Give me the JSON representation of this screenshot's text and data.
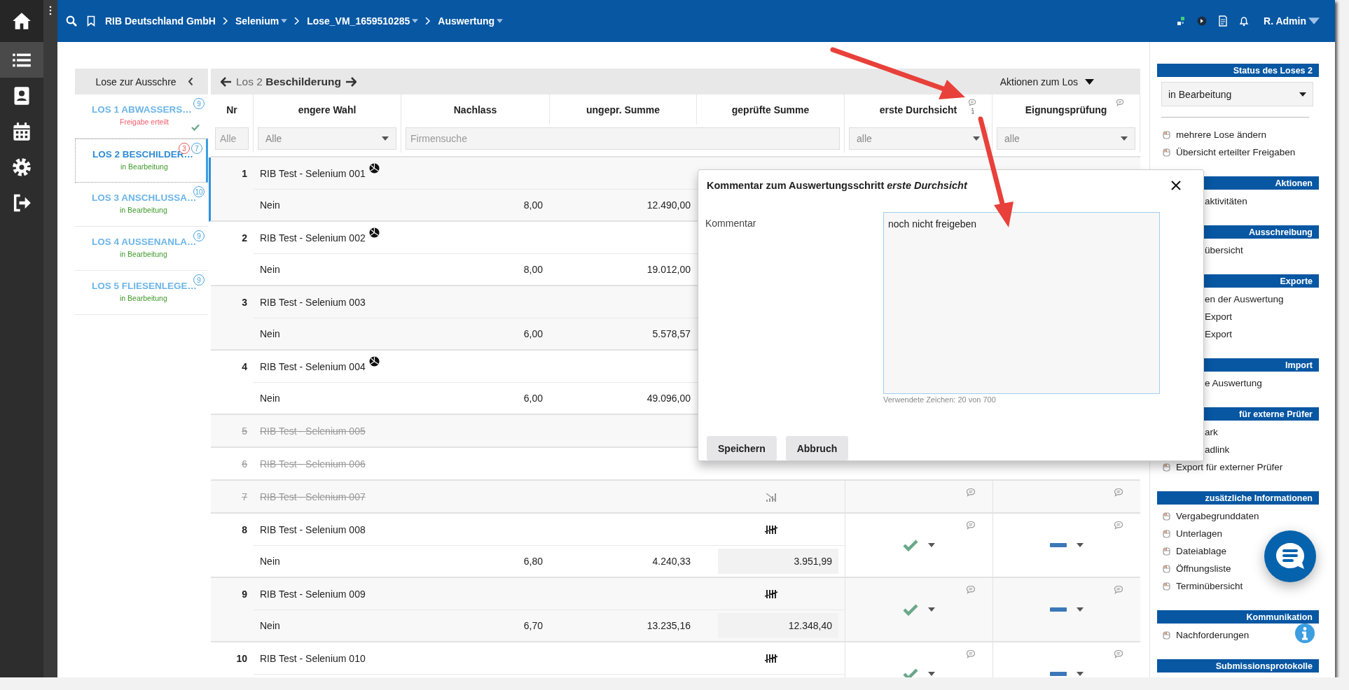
{
  "nav": [
    {
      "kind": "home",
      "selected": false
    },
    {
      "kind": "list",
      "selected": true
    },
    {
      "kind": "contacts",
      "selected": false
    },
    {
      "kind": "calendar",
      "selected": false
    },
    {
      "kind": "settings",
      "selected": false
    },
    {
      "kind": "logout",
      "selected": false
    }
  ],
  "topbar": {
    "breadcrumb": [
      {
        "label": "RIB Deutschland GmbH",
        "dropdown": false
      },
      {
        "label": "Selenium",
        "dropdown": true
      },
      {
        "label": "Lose_VM_1659510285",
        "dropdown": true
      },
      {
        "label": "Auswertung",
        "dropdown": true
      }
    ],
    "user": "R. Admin"
  },
  "lots_panel": {
    "title": "Lose zur Ausschre",
    "lots": [
      {
        "title": "LOS 1 ABWASSERS…",
        "status": "Freigabe erteilt",
        "released": true,
        "approved": true,
        "selected": false,
        "badges": [
          {
            "text": "9",
            "kind": "info"
          }
        ]
      },
      {
        "title": "LOS 2 BESCHILDER…",
        "status": "in Bearbeitung",
        "released": false,
        "approved": false,
        "selected": true,
        "badges": [
          {
            "text": "3",
            "kind": "alert"
          },
          {
            "text": "7",
            "kind": "info"
          }
        ]
      },
      {
        "title": "LOS 3 ANSCHLUSSA…",
        "status": "in Bearbeitung",
        "released": false,
        "approved": false,
        "selected": false,
        "badges": [
          {
            "text": "10",
            "kind": "info"
          }
        ]
      },
      {
        "title": "LOS 4 AUSSENANLA…",
        "status": "in Bearbeitung",
        "released": false,
        "approved": false,
        "selected": false,
        "badges": [
          {
            "text": "9",
            "kind": "info"
          }
        ]
      },
      {
        "title": "LOS 5 FLIESENLEGE…",
        "status": "in Bearbeitung",
        "released": false,
        "approved": false,
        "selected": false,
        "badges": [
          {
            "text": "9",
            "kind": "info"
          }
        ]
      }
    ]
  },
  "table": {
    "lot_title": "Los 2 **Beschilderung**",
    "actions": "Aktionen zum Los",
    "columns": [
      {
        "label": "Nr",
        "comments": false
      },
      {
        "label": "engere Wahl",
        "comments": false
      },
      {
        "label": "Nachlass",
        "comments": false
      },
      {
        "label": "ungepr. Summe",
        "comments": false
      },
      {
        "label": "geprüfte Summe",
        "comments": false
      },
      {
        "label": "erste Durchsicht",
        "comments": true,
        "info": true
      },
      {
        "label": "Eignungsprüfung",
        "comments": true,
        "info": false
      }
    ],
    "filters": [
      {
        "kind": "input",
        "placeholder": "Alle"
      },
      {
        "kind": "select",
        "value": "Alle"
      },
      {
        "kind": "search",
        "placeholder": "Firmensuche"
      },
      {
        "kind": "select",
        "value": "alle"
      },
      {
        "kind": "select",
        "value": "alle"
      }
    ],
    "rows": [
      {
        "nr": "1",
        "name": "RIB Test - Selenium 001",
        "emblem": true,
        "struck": false,
        "selected": true,
        "shortlist": "Nein",
        "discount": "8,00",
        "unchecked_sum": "12.490,00"
      },
      {
        "nr": "2",
        "name": "RIB Test - Selenium 002",
        "emblem": true,
        "struck": false,
        "selected": false,
        "shortlist": "Nein",
        "discount": "8,00",
        "unchecked_sum": "19.012,00"
      },
      {
        "nr": "3",
        "name": "RIB Test - Selenium 003",
        "emblem": false,
        "struck": false,
        "selected": false,
        "shortlist": "Nein",
        "discount": "6,00",
        "unchecked_sum": "5.578,57"
      },
      {
        "nr": "4",
        "name": "RIB Test - Selenium 004",
        "emblem": true,
        "struck": false,
        "selected": false,
        "shortlist": "Nein",
        "discount": "6,00",
        "unchecked_sum": "49.096,00"
      },
      {
        "nr": "5",
        "name": "RIB Test - Selenium 005",
        "emblem": false,
        "struck": true,
        "selected": false
      },
      {
        "nr": "6",
        "name": "RIB Test - Selenium 006",
        "emblem": false,
        "struck": true,
        "selected": false
      },
      {
        "nr": "7",
        "name": "RIB Test - Selenium 007",
        "emblem": false,
        "struck": true,
        "selected": false,
        "sum_mark": {
          "kind": "crossed"
        },
        "first_review": {
          "kind": "none"
        },
        "suitability": {
          "kind": "none"
        }
      },
      {
        "nr": "8",
        "name": "RIB Test - Selenium 008",
        "emblem": false,
        "struck": false,
        "selected": false,
        "sum_mark": {
          "kind": "tally"
        },
        "shortlist": "Nein",
        "discount": "6,80",
        "unchecked_sum": "4.240,33",
        "checked_sum": "3.951,99",
        "first_review": {
          "kind": "ok"
        },
        "suitability": {
          "kind": "pending"
        }
      },
      {
        "nr": "9",
        "name": "RIB Test - Selenium 009",
        "emblem": false,
        "struck": false,
        "selected": false,
        "sum_mark": {
          "kind": "tally"
        },
        "shortlist": "Nein",
        "discount": "6,70",
        "unchecked_sum": "13.235,16",
        "checked_sum": "12.348,40",
        "first_review": {
          "kind": "ok"
        },
        "suitability": {
          "kind": "pending"
        }
      },
      {
        "nr": "10",
        "name": "RIB Test - Selenium 010",
        "emblem": false,
        "struck": false,
        "selected": false,
        "sum_mark": {
          "kind": "tally"
        },
        "first_review": {
          "kind": "ok"
        },
        "suitability": {
          "kind": "pending"
        }
      }
    ]
  },
  "dialog": {
    "title": "Kommentar zum Auswertungsschritt *erste Durchsicht*",
    "label": "Kommentar",
    "value": "noch nicht freigeben",
    "counter": "Verwendete Zeichen: 20 von 700",
    "buttons": [
      "Speichern",
      "Abbruch"
    ]
  },
  "right_panel": {
    "status_title": "Status des Loses 2",
    "status_value": "in Bearbeitung",
    "sections": [
      {
        "items": [
          {
            "label": "mehrere Lose ändern",
            "covered": false
          },
          {
            "label": "Übersicht erteilter Freigaben",
            "covered": false
          }
        ]
      },
      {
        "title": "Aktionen",
        "items": [
          {
            "label": "aktivitäten",
            "covered": true
          }
        ]
      },
      {
        "title": "Ausschreibung",
        "items": [
          {
            "label": "übersicht",
            "covered": true
          }
        ]
      },
      {
        "title": "Exporte",
        "items": [
          {
            "label": "en der Auswertung",
            "covered": true
          },
          {
            "label": "Export",
            "covered": true
          },
          {
            "label": "Export",
            "covered": true
          }
        ]
      },
      {
        "title": "Import",
        "items": [
          {
            "label": "e Auswertung",
            "covered": true
          }
        ]
      },
      {
        "title": "für externe Prüfer",
        "items": [
          {
            "label": "ark",
            "covered": true
          },
          {
            "label": "adlink",
            "covered": true
          },
          {
            "label": "Export für externer Prüfer",
            "covered": false
          }
        ]
      },
      {
        "title": "zusätzliche Informationen",
        "items": [
          {
            "label": "Vergabegrunddaten",
            "covered": false
          },
          {
            "label": "Unterlagen",
            "covered": false
          },
          {
            "label": "Dateiablage",
            "covered": false
          },
          {
            "label": "Öffnungsliste",
            "covered": false
          },
          {
            "label": "Terminübersicht",
            "covered": false
          }
        ]
      },
      {
        "title": "Kommunikation",
        "items": [
          {
            "label": "Nachforderungen",
            "covered": false
          }
        ]
      },
      {
        "title": "Submissionsprotokolle"
      }
    ]
  }
}
